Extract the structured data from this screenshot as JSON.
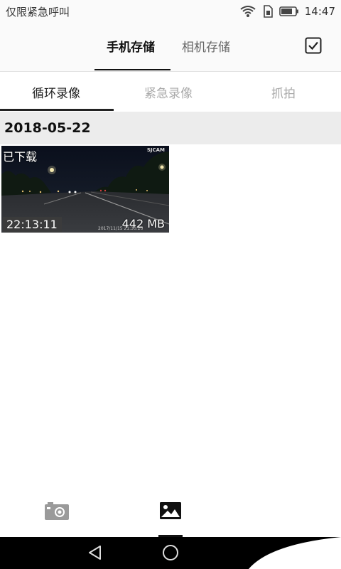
{
  "status_bar": {
    "carrier": "仅限紧急呼叫",
    "time": "14:47"
  },
  "storage_tabs": [
    {
      "label": "手机存储",
      "active": true
    },
    {
      "label": "相机存储",
      "active": false
    }
  ],
  "category_tabs": [
    {
      "label": "循环录像",
      "active": true
    },
    {
      "label": "紧急录像",
      "active": false
    },
    {
      "label": "抓拍",
      "active": false
    }
  ],
  "gallery": {
    "date": "2018-05-22",
    "items": [
      {
        "badge": "已下载",
        "brand": "SJCAM",
        "stamp": "2017/11/15  21:30:20",
        "duration": "22:13:11",
        "size": "442 MB"
      }
    ]
  },
  "bottom_nav": [
    {
      "icon": "camera-icon",
      "active": false
    },
    {
      "icon": "gallery-icon",
      "active": true
    }
  ],
  "colors": {
    "accent": "#111111",
    "inactive_text": "#aaaaaa",
    "date_header_bg": "#ececec"
  }
}
